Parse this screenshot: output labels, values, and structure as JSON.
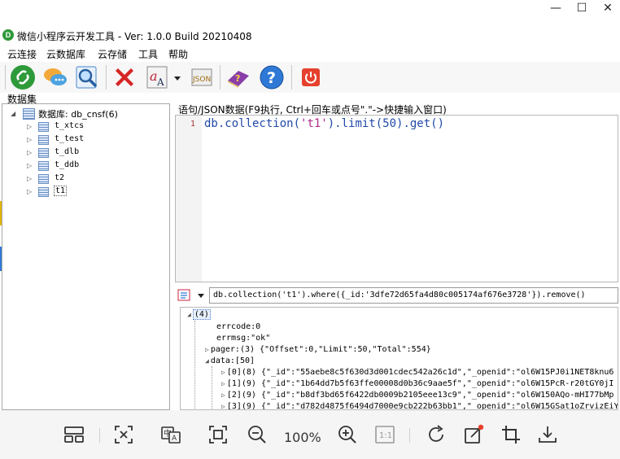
{
  "window": {
    "title": "微信小程序云开发工具 - Ver: 1.0.0 Build 20210408",
    "icon_glyph": "D",
    "minimize_glyph": "—",
    "maximize_glyph": "☐",
    "close_glyph": "✕"
  },
  "menu": {
    "items": [
      "云连接",
      "云数据库",
      "云存储",
      "工具",
      "帮助"
    ]
  },
  "toolbar": {
    "buttons": [
      {
        "name": "connect",
        "icon": "green-link-icon"
      },
      {
        "name": "chat",
        "icon": "chat-bubbles-icon"
      },
      {
        "name": "search",
        "icon": "magnifier-icon"
      },
      {
        "name": "delete",
        "icon": "red-x-icon"
      },
      {
        "name": "font",
        "icon": "font-a-icon"
      },
      {
        "name": "json",
        "icon": "json-icon",
        "label": "JSON"
      },
      {
        "name": "book",
        "icon": "help-book-icon"
      },
      {
        "name": "help",
        "icon": "question-icon",
        "label": "?"
      },
      {
        "name": "power",
        "icon": "power-icon"
      }
    ]
  },
  "dataset_label": "数据集",
  "tree": {
    "root_label": "数据库: db_cnsf(6)",
    "collections": [
      "t_xtcs",
      "t_test",
      "t_dlb",
      "t_ddb",
      "t2",
      "t1"
    ],
    "selected": "t1"
  },
  "editor": {
    "label": "语句/JSON数据(F9执行, Ctrl+回车或点号\".\"->快捷输入窗口)",
    "line_number": "1",
    "code_prefix": "db.collection(",
    "code_string": "'t1'",
    "code_suffix": ").limit(50).get()"
  },
  "history": {
    "value": "db.collection('t1').where({_id:'3dfe72d65fa4d80c005174af676e3728'}).remove()"
  },
  "result": {
    "root": "(4)",
    "lines": [
      {
        "indent": 1,
        "exp": "",
        "text": "errcode:0"
      },
      {
        "indent": 1,
        "exp": "",
        "text": "errmsg:\"ok\""
      },
      {
        "indent": 1,
        "exp": "▷",
        "text": "pager:(3) {\"Offset\":0,\"Limit\":50,\"Total\":554}"
      },
      {
        "indent": 1,
        "exp": "◢",
        "text": "data:[50]"
      },
      {
        "indent": 2,
        "exp": "▷",
        "text": "[0](8) {\"_id\":\"55aebe8c5f630d3d001cdec542a26c1d\",\"_openid\":\"ol6W15PJ0i1NET8knu6"
      },
      {
        "indent": 2,
        "exp": "▷",
        "text": "[1](9) {\"_id\":\"1b64dd7b5f63ffe00008d0b36c9aae5f\",\"_openid\":\"ol6W15PcR-r20tGY0jI"
      },
      {
        "indent": 2,
        "exp": "▷",
        "text": "[2](9) {\"_id\":\"b8df3bd65f6422db0009b2105eee13c9\",\"_openid\":\"ol6W150AQo-mHI77bMp"
      },
      {
        "indent": 2,
        "exp": "▷",
        "text": "[3](9) {\"_id\":\"d782d4875f6494d7000e9cb222b63bb1\",\"_openid\":\"ol6W15GSat1oZrvizEiY"
      }
    ]
  },
  "viewer": {
    "zoom": "100%",
    "buttons": [
      "thumbnails-icon",
      "fit-window-icon",
      "translate-icon",
      "actual-size-icon",
      "zoom-out-icon",
      "zoom-in-icon",
      "one-to-one-icon",
      "rotate-icon",
      "edit-icon",
      "crop-icon",
      "download-icon"
    ],
    "one_to_one_label": "1:1"
  },
  "colors": {
    "code_blue": "#2149a8",
    "code_string": "#b02a8a",
    "accent_green": "#2e9a3a",
    "delete_red": "#d62424"
  }
}
